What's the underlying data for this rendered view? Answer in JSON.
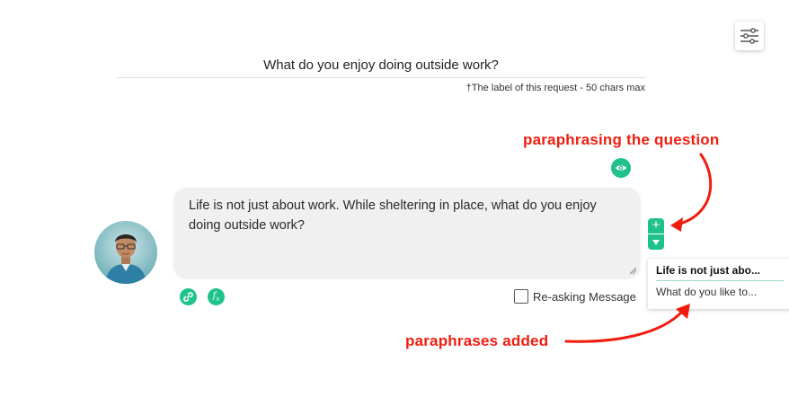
{
  "request_label": {
    "value": "What do you enjoy doing outside work?",
    "hint": "†The label of this request - 50 chars max"
  },
  "message": {
    "text": "Life is not just about work. While sheltering in place, what do you enjoy doing outside work?"
  },
  "reasking": {
    "label": "Re-asking Message",
    "checked": false
  },
  "paraphrases": {
    "add_label": "+",
    "items": [
      "Life is not just abo...",
      "What do you like to..."
    ]
  },
  "annotations": {
    "paraphrasing": "paraphrasing the question",
    "added": "paraphrases added"
  },
  "icons": {
    "settings": "sliders-icon",
    "preview": "eye-icon",
    "expand": "caret-down-icon",
    "link": "link-icon",
    "function": "function-icon"
  },
  "colors": {
    "accent": "#1fc28a",
    "annotation": "#f01d0f",
    "bubble": "#f0f0f0"
  }
}
